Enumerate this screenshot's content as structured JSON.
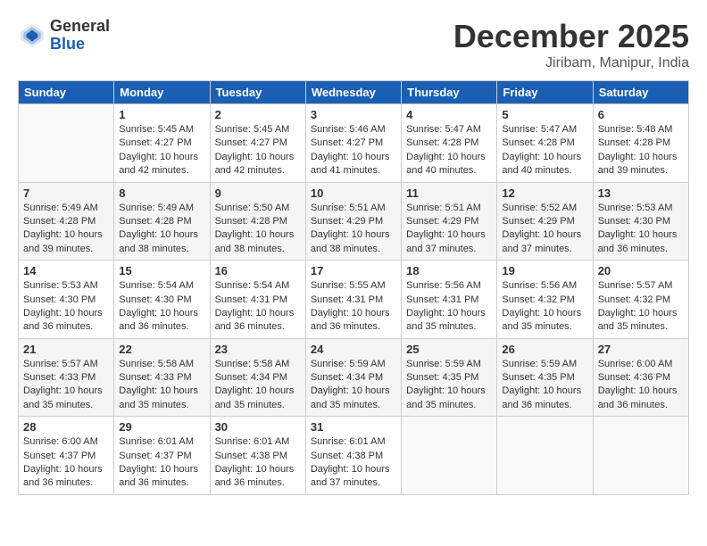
{
  "logo": {
    "general": "General",
    "blue": "Blue"
  },
  "header": {
    "month": "December 2025",
    "location": "Jiribam, Manipur, India"
  },
  "weekdays": [
    "Sunday",
    "Monday",
    "Tuesday",
    "Wednesday",
    "Thursday",
    "Friday",
    "Saturday"
  ],
  "weeks": [
    [
      {
        "day": "",
        "sunrise": "",
        "sunset": "",
        "daylight": ""
      },
      {
        "day": "1",
        "sunrise": "Sunrise: 5:45 AM",
        "sunset": "Sunset: 4:27 PM",
        "daylight": "Daylight: 10 hours and 42 minutes."
      },
      {
        "day": "2",
        "sunrise": "Sunrise: 5:45 AM",
        "sunset": "Sunset: 4:27 PM",
        "daylight": "Daylight: 10 hours and 42 minutes."
      },
      {
        "day": "3",
        "sunrise": "Sunrise: 5:46 AM",
        "sunset": "Sunset: 4:27 PM",
        "daylight": "Daylight: 10 hours and 41 minutes."
      },
      {
        "day": "4",
        "sunrise": "Sunrise: 5:47 AM",
        "sunset": "Sunset: 4:28 PM",
        "daylight": "Daylight: 10 hours and 40 minutes."
      },
      {
        "day": "5",
        "sunrise": "Sunrise: 5:47 AM",
        "sunset": "Sunset: 4:28 PM",
        "daylight": "Daylight: 10 hours and 40 minutes."
      },
      {
        "day": "6",
        "sunrise": "Sunrise: 5:48 AM",
        "sunset": "Sunset: 4:28 PM",
        "daylight": "Daylight: 10 hours and 39 minutes."
      }
    ],
    [
      {
        "day": "7",
        "sunrise": "Sunrise: 5:49 AM",
        "sunset": "Sunset: 4:28 PM",
        "daylight": "Daylight: 10 hours and 39 minutes."
      },
      {
        "day": "8",
        "sunrise": "Sunrise: 5:49 AM",
        "sunset": "Sunset: 4:28 PM",
        "daylight": "Daylight: 10 hours and 38 minutes."
      },
      {
        "day": "9",
        "sunrise": "Sunrise: 5:50 AM",
        "sunset": "Sunset: 4:28 PM",
        "daylight": "Daylight: 10 hours and 38 minutes."
      },
      {
        "day": "10",
        "sunrise": "Sunrise: 5:51 AM",
        "sunset": "Sunset: 4:29 PM",
        "daylight": "Daylight: 10 hours and 38 minutes."
      },
      {
        "day": "11",
        "sunrise": "Sunrise: 5:51 AM",
        "sunset": "Sunset: 4:29 PM",
        "daylight": "Daylight: 10 hours and 37 minutes."
      },
      {
        "day": "12",
        "sunrise": "Sunrise: 5:52 AM",
        "sunset": "Sunset: 4:29 PM",
        "daylight": "Daylight: 10 hours and 37 minutes."
      },
      {
        "day": "13",
        "sunrise": "Sunrise: 5:53 AM",
        "sunset": "Sunset: 4:30 PM",
        "daylight": "Daylight: 10 hours and 36 minutes."
      }
    ],
    [
      {
        "day": "14",
        "sunrise": "Sunrise: 5:53 AM",
        "sunset": "Sunset: 4:30 PM",
        "daylight": "Daylight: 10 hours and 36 minutes."
      },
      {
        "day": "15",
        "sunrise": "Sunrise: 5:54 AM",
        "sunset": "Sunset: 4:30 PM",
        "daylight": "Daylight: 10 hours and 36 minutes."
      },
      {
        "day": "16",
        "sunrise": "Sunrise: 5:54 AM",
        "sunset": "Sunset: 4:31 PM",
        "daylight": "Daylight: 10 hours and 36 minutes."
      },
      {
        "day": "17",
        "sunrise": "Sunrise: 5:55 AM",
        "sunset": "Sunset: 4:31 PM",
        "daylight": "Daylight: 10 hours and 36 minutes."
      },
      {
        "day": "18",
        "sunrise": "Sunrise: 5:56 AM",
        "sunset": "Sunset: 4:31 PM",
        "daylight": "Daylight: 10 hours and 35 minutes."
      },
      {
        "day": "19",
        "sunrise": "Sunrise: 5:56 AM",
        "sunset": "Sunset: 4:32 PM",
        "daylight": "Daylight: 10 hours and 35 minutes."
      },
      {
        "day": "20",
        "sunrise": "Sunrise: 5:57 AM",
        "sunset": "Sunset: 4:32 PM",
        "daylight": "Daylight: 10 hours and 35 minutes."
      }
    ],
    [
      {
        "day": "21",
        "sunrise": "Sunrise: 5:57 AM",
        "sunset": "Sunset: 4:33 PM",
        "daylight": "Daylight: 10 hours and 35 minutes."
      },
      {
        "day": "22",
        "sunrise": "Sunrise: 5:58 AM",
        "sunset": "Sunset: 4:33 PM",
        "daylight": "Daylight: 10 hours and 35 minutes."
      },
      {
        "day": "23",
        "sunrise": "Sunrise: 5:58 AM",
        "sunset": "Sunset: 4:34 PM",
        "daylight": "Daylight: 10 hours and 35 minutes."
      },
      {
        "day": "24",
        "sunrise": "Sunrise: 5:59 AM",
        "sunset": "Sunset: 4:34 PM",
        "daylight": "Daylight: 10 hours and 35 minutes."
      },
      {
        "day": "25",
        "sunrise": "Sunrise: 5:59 AM",
        "sunset": "Sunset: 4:35 PM",
        "daylight": "Daylight: 10 hours and 35 minutes."
      },
      {
        "day": "26",
        "sunrise": "Sunrise: 5:59 AM",
        "sunset": "Sunset: 4:35 PM",
        "daylight": "Daylight: 10 hours and 36 minutes."
      },
      {
        "day": "27",
        "sunrise": "Sunrise: 6:00 AM",
        "sunset": "Sunset: 4:36 PM",
        "daylight": "Daylight: 10 hours and 36 minutes."
      }
    ],
    [
      {
        "day": "28",
        "sunrise": "Sunrise: 6:00 AM",
        "sunset": "Sunset: 4:37 PM",
        "daylight": "Daylight: 10 hours and 36 minutes."
      },
      {
        "day": "29",
        "sunrise": "Sunrise: 6:01 AM",
        "sunset": "Sunset: 4:37 PM",
        "daylight": "Daylight: 10 hours and 36 minutes."
      },
      {
        "day": "30",
        "sunrise": "Sunrise: 6:01 AM",
        "sunset": "Sunset: 4:38 PM",
        "daylight": "Daylight: 10 hours and 36 minutes."
      },
      {
        "day": "31",
        "sunrise": "Sunrise: 6:01 AM",
        "sunset": "Sunset: 4:38 PM",
        "daylight": "Daylight: 10 hours and 37 minutes."
      },
      {
        "day": "",
        "sunrise": "",
        "sunset": "",
        "daylight": ""
      },
      {
        "day": "",
        "sunrise": "",
        "sunset": "",
        "daylight": ""
      },
      {
        "day": "",
        "sunrise": "",
        "sunset": "",
        "daylight": ""
      }
    ]
  ]
}
